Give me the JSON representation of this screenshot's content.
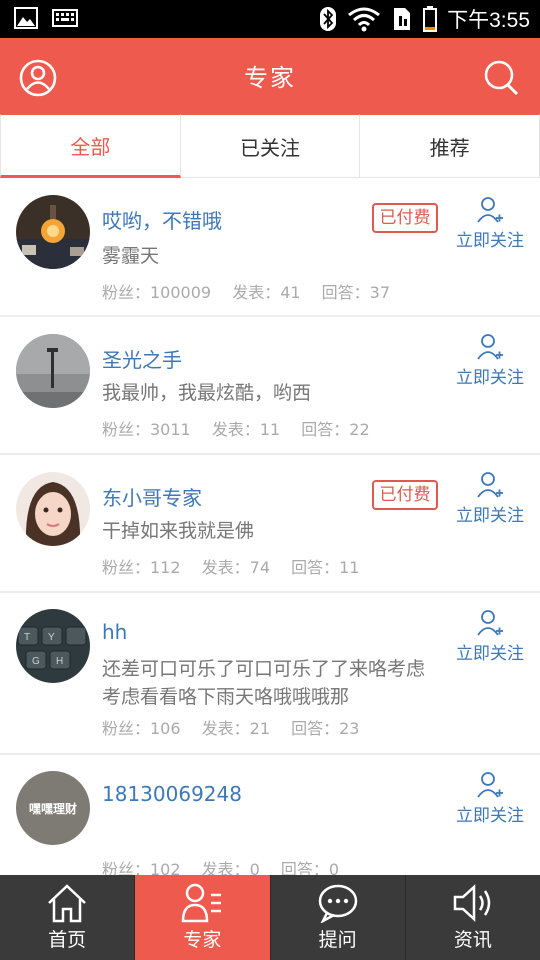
{
  "status_bar": {
    "time": "下午3:55"
  },
  "header": {
    "title": "专家"
  },
  "tabs": [
    {
      "label": "全部",
      "active": true
    },
    {
      "label": "已关注",
      "active": false
    },
    {
      "label": "推荐",
      "active": false
    }
  ],
  "experts": [
    {
      "name": "哎哟，不错哦",
      "desc": "雾霾天",
      "paid_badge": "已付费",
      "fans": "粉丝：100009",
      "posts": "发表：41",
      "answers": "回答：37",
      "follow_label": "立即关注"
    },
    {
      "name": "圣光之手",
      "desc": "我最帅，我最炫酷，哟西",
      "fans": "粉丝：3011",
      "posts": "发表：11",
      "answers": "回答：22",
      "follow_label": "立即关注"
    },
    {
      "name": "东小哥专家",
      "desc": "干掉如来我就是佛",
      "paid_badge": "已付费",
      "fans": "粉丝：112",
      "posts": "发表：74",
      "answers": "回答：11",
      "follow_label": "立即关注"
    },
    {
      "name": "hh",
      "desc": "还差可口可乐了可口可乐了了来咯考虑考虑看看咯下雨天咯哦哦哦那",
      "fans": "粉丝：106",
      "posts": "发表：21",
      "answers": "回答：23",
      "follow_label": "立即关注"
    },
    {
      "name": "18130069248",
      "avatar_text": "嘿嘿理财",
      "fans": "粉丝：102",
      "posts": "发表：0",
      "answers": "回答：0",
      "follow_label": "立即关注"
    }
  ],
  "bottom_nav": [
    {
      "label": "首页",
      "icon": "home-icon",
      "active": false
    },
    {
      "label": "专家",
      "icon": "experts-icon",
      "active": true
    },
    {
      "label": "提问",
      "icon": "chat-bubble-icon",
      "active": false
    },
    {
      "label": "资讯",
      "icon": "speaker-icon",
      "active": false
    }
  ],
  "colors": {
    "accent": "#ef5a4e",
    "link": "#3d78b8",
    "nav_bg": "#3a3a3a"
  }
}
